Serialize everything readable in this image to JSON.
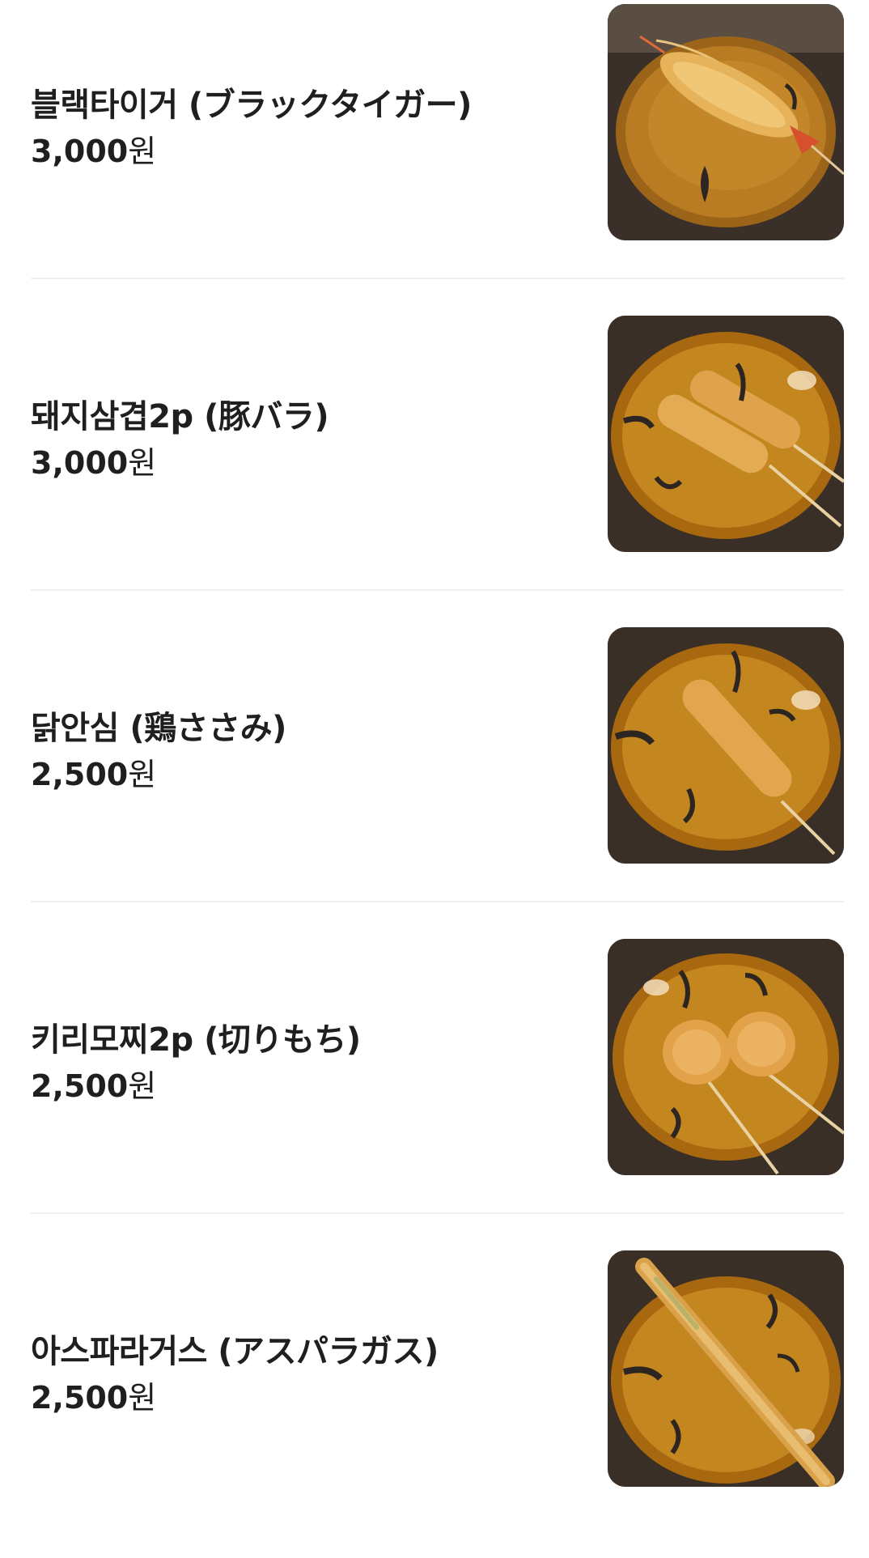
{
  "menu": {
    "items": [
      {
        "name": "블랙타이거 (ブラックタイガー)",
        "price": "3,000",
        "currency": "원",
        "thumb": "black-tiger-shrimp-photo"
      },
      {
        "name": "돼지삼겹2p (豚バラ)",
        "price": "3,000",
        "currency": "원",
        "thumb": "pork-belly-skewers-photo"
      },
      {
        "name": "닭안심 (鶏ささみ)",
        "price": "2,500",
        "currency": "원",
        "thumb": "chicken-tender-skewer-photo"
      },
      {
        "name": "키리모찌2p (切りもち)",
        "price": "2,500",
        "currency": "원",
        "thumb": "kirimochi-skewers-photo"
      },
      {
        "name": "아스파라거스 (アスパラガス)",
        "price": "2,500",
        "currency": "원",
        "thumb": "asparagus-skewer-photo"
      }
    ]
  },
  "colors": {
    "background": "#ffffff",
    "text": "#1f1f1f",
    "divider": "#f0f0f0",
    "plate": "#b87a1c",
    "fried": "#e3a54a",
    "table": "#3a2f27"
  }
}
